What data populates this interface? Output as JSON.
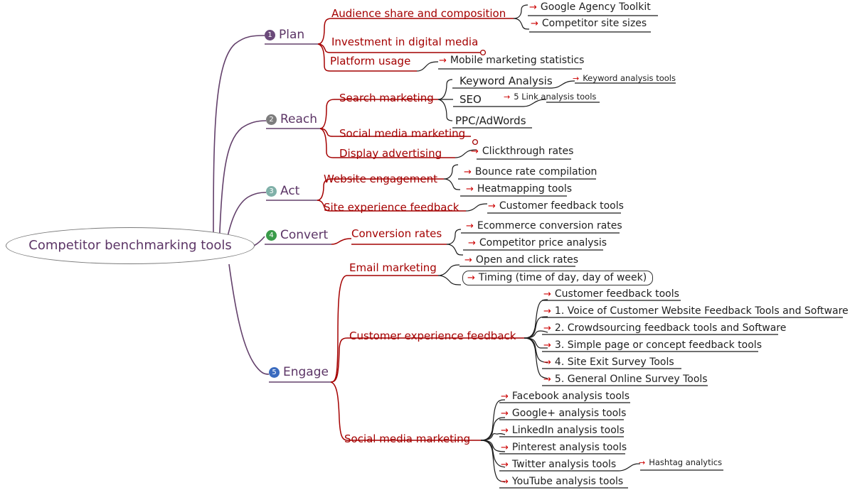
{
  "root": {
    "label": "Competitor benchmarking tools"
  },
  "icons": {
    "arrow": "→"
  },
  "colors": {
    "root_text": "#5c3566",
    "branch_text": "#5c3566",
    "level2_text": "#a40000",
    "leaf_text": "#202020",
    "arrow": "#cc0000",
    "connector_purple": "#63406b",
    "connector_red": "#a40000",
    "connector_dark": "#1a1a1a",
    "root_border": "#7a7a7a",
    "badge_1": "#6b4a7a",
    "badge_2": "#7d7d7d",
    "badge_3": "#7fb0a8",
    "badge_4": "#3a9b4a",
    "badge_5": "#3a6bbf"
  },
  "branches": [
    {
      "num": "❶",
      "number": "1",
      "label": "Plan",
      "badge_color": "#6b4a7a",
      "topics": [
        {
          "label": "Audience share and composition",
          "leaves": [
            {
              "label": "Google Agency Toolkit"
            },
            {
              "label": "Competitor site sizes"
            }
          ]
        },
        {
          "label": "Investment in digital media",
          "endpoint": "circle",
          "leaves": []
        },
        {
          "label": "Platform usage",
          "leaves": [
            {
              "label": "Mobile marketing statistics"
            }
          ]
        }
      ]
    },
    {
      "num": "❷",
      "number": "2",
      "label": "Reach",
      "badge_color": "#7d7d7d",
      "topics": [
        {
          "label": "Search marketing",
          "subtopics": [
            {
              "label": "Keyword Analysis",
              "leaves": [
                {
                  "label": "Keyword analysis tools"
                }
              ]
            },
            {
              "label": "SEO",
              "leaves": [
                {
                  "label": "5 Link analysis tools"
                }
              ]
            },
            {
              "label": "PPC/AdWords",
              "leaves": []
            }
          ]
        },
        {
          "label": "Social media marketing",
          "endpoint": "circle",
          "leaves": []
        },
        {
          "label": "Display advertising",
          "leaves": [
            {
              "label": "Clickthrough rates"
            }
          ]
        }
      ]
    },
    {
      "num": "❸",
      "number": "3",
      "label": "Act",
      "badge_color": "#7fb0a8",
      "topics": [
        {
          "label": "Website engagement",
          "leaves": [
            {
              "label": "Bounce rate compilation"
            },
            {
              "label": "Heatmapping tools"
            }
          ]
        },
        {
          "label": "Site experience feedback",
          "leaves": [
            {
              "label": "Customer feedback  tools"
            }
          ]
        }
      ]
    },
    {
      "num": "❹",
      "number": "4",
      "label": "Convert",
      "badge_color": "#3a9b4a",
      "topics": [
        {
          "label": "Conversion rates",
          "leaves": [
            {
              "label": "Ecommerce conversion rates"
            },
            {
              "label": "Competitor price analysis"
            }
          ]
        }
      ]
    },
    {
      "num": "❺",
      "number": "5",
      "label": "Engage",
      "badge_color": "#3a6bbf",
      "topics": [
        {
          "label": "Email marketing",
          "leaves": [
            {
              "label": "Open and click rates"
            },
            {
              "label": "Timing (time of day, day of week)",
              "boxed": true
            }
          ]
        },
        {
          "label": "Customer experience feedback",
          "leaves": [
            {
              "label": "Customer feedback  tools"
            },
            {
              "label": "1. Voice of Customer Website Feedback Tools and Software"
            },
            {
              "label": "2. Crowdsourcing feedback tools and Software"
            },
            {
              "label": "3. Simple page or concept feedback tools"
            },
            {
              "label": "4. Site Exit Survey Tools"
            },
            {
              "label": "5. General Online Survey Tools"
            }
          ]
        },
        {
          "label": "Social media marketing",
          "leaves": [
            {
              "label": "Facebook analysis tools"
            },
            {
              "label": "Google+ analysis tools"
            },
            {
              "label": "LinkedIn analysis tools"
            },
            {
              "label": "Pinterest analysis tools"
            },
            {
              "label": "Twitter analysis tools",
              "leaves": [
                {
                  "label": "Hashtag analytics"
                }
              ]
            },
            {
              "label": "YouTube analysis tools"
            }
          ]
        }
      ]
    }
  ]
}
